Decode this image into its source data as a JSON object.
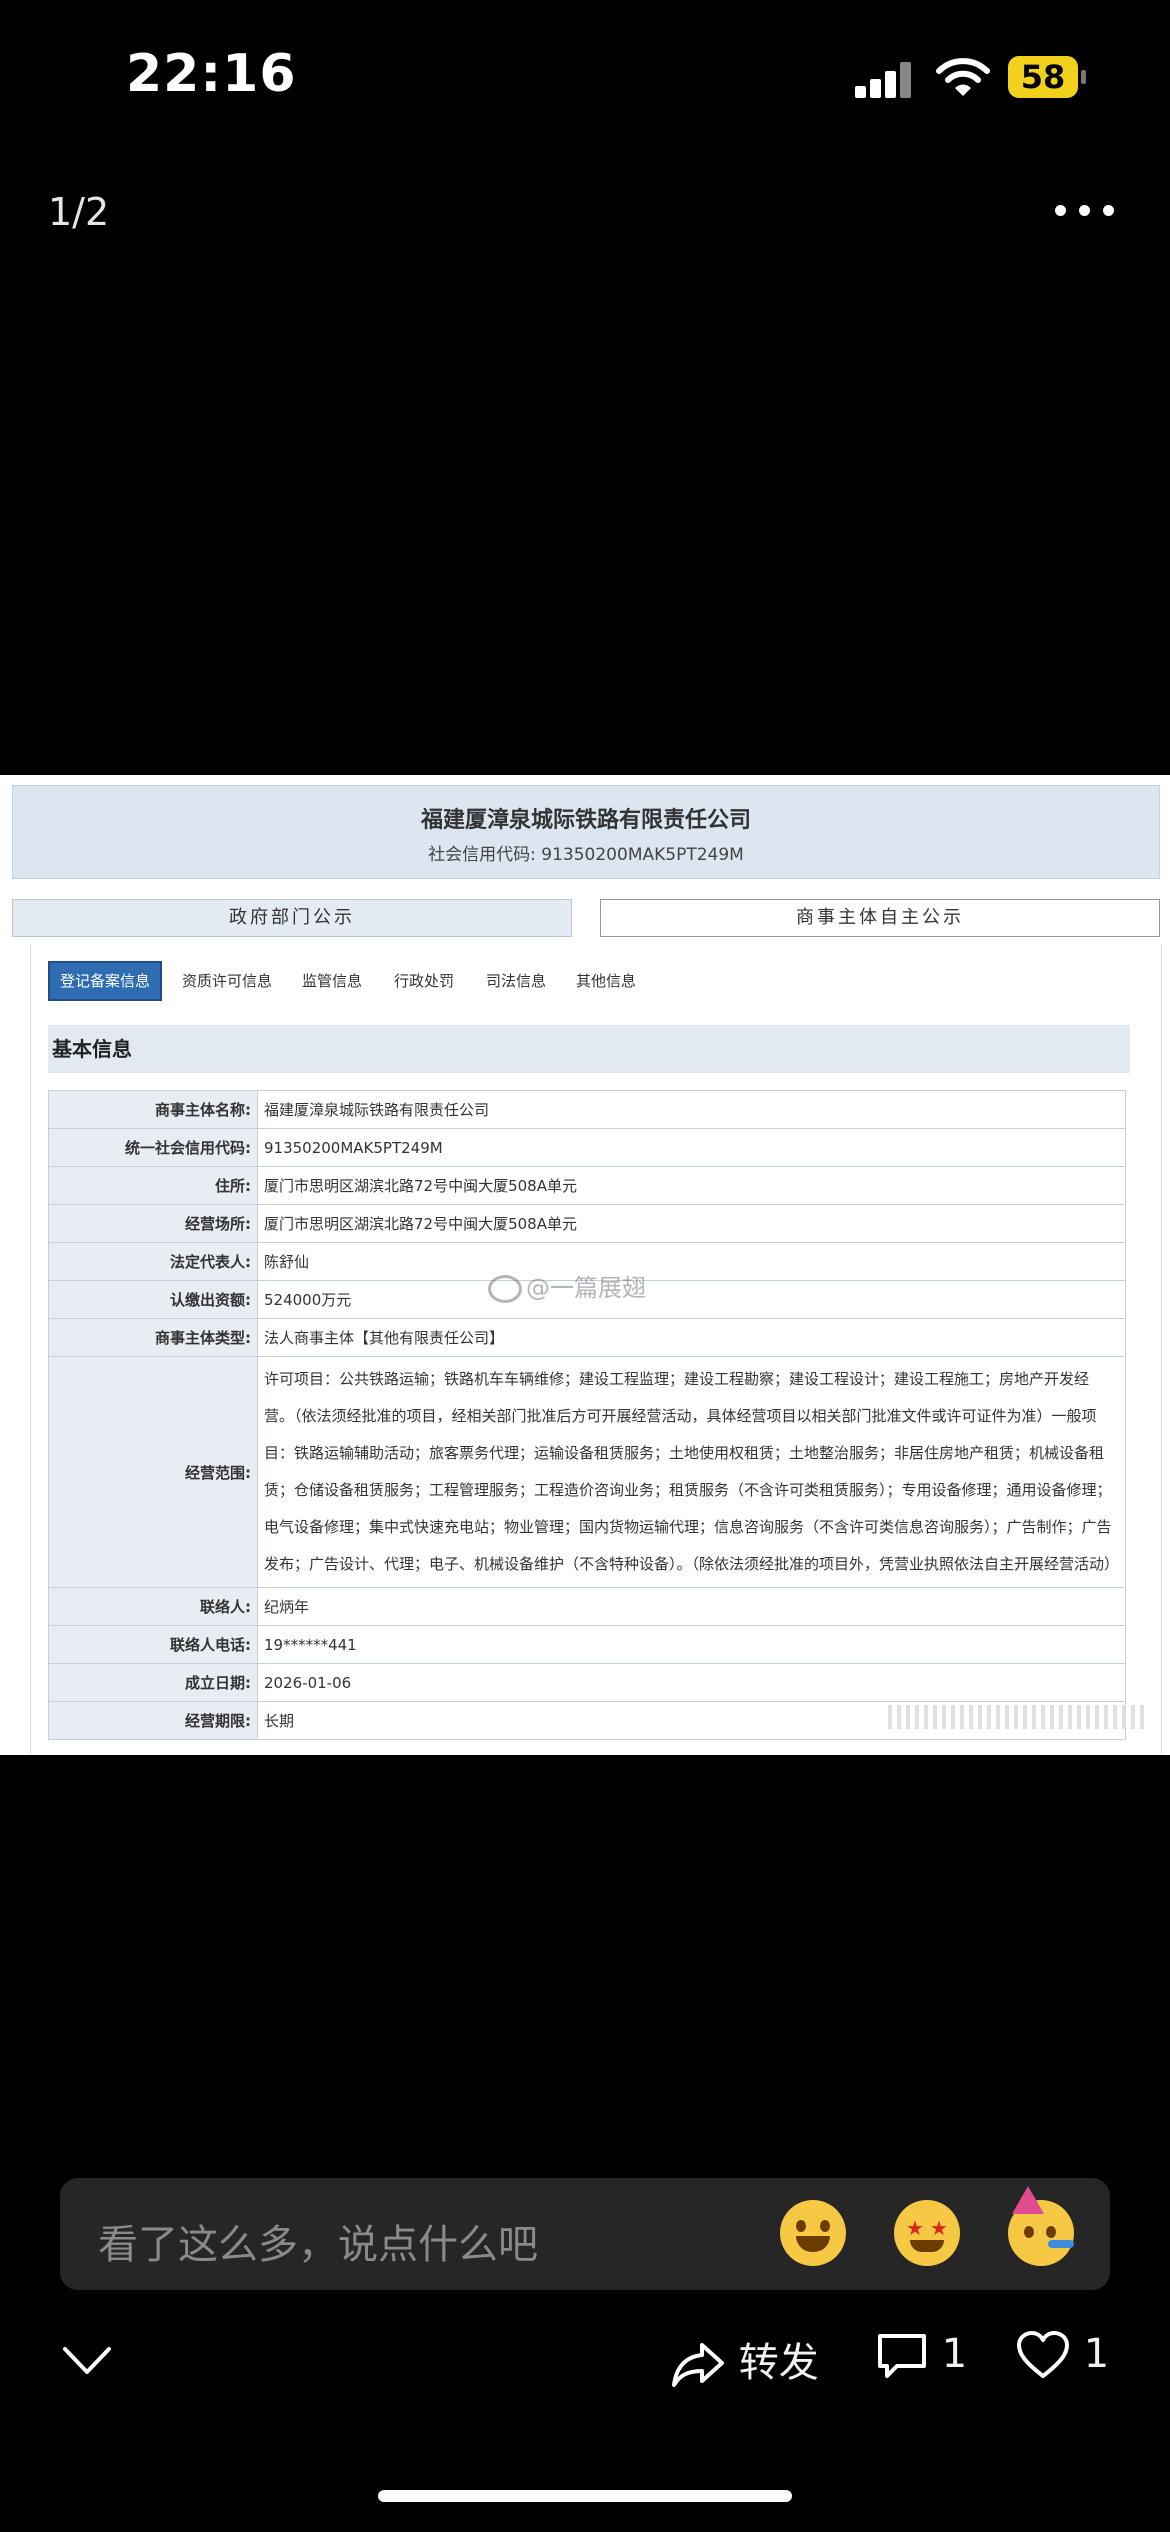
{
  "status_bar": {
    "time": "22:16",
    "battery": "58"
  },
  "viewer": {
    "page_counter": "1/2"
  },
  "document": {
    "company_title": "福建厦漳泉城际铁路有限责任公司",
    "credit_code_line": "社会信用代码: 91350200MAK5PT249M",
    "tab_gov": "政府部门公示",
    "tab_self": "商事主体自主公示",
    "subtabs": [
      "登记备案信息",
      "资质许可信息",
      "监管信息",
      "行政处罚",
      "司法信息",
      "其他信息"
    ],
    "section_title": "基本信息",
    "rows": [
      {
        "label": "商事主体名称:",
        "value": "福建厦漳泉城际铁路有限责任公司"
      },
      {
        "label": "统一社会信用代码:",
        "value": "91350200MAK5PT249M"
      },
      {
        "label": "住所:",
        "value": "厦门市思明区湖滨北路72号中闽大厦508A单元"
      },
      {
        "label": "经营场所:",
        "value": "厦门市思明区湖滨北路72号中闽大厦508A单元"
      },
      {
        "label": "法定代表人:",
        "value": "陈舒仙"
      },
      {
        "label": "认缴出资额:",
        "value": "524000万元"
      },
      {
        "label": "商事主体类型:",
        "value": "法人商事主体【其他有限责任公司】"
      },
      {
        "label": "经营范围:",
        "value": "许可项目：公共铁路运输；铁路机车车辆维修；建设工程监理；建设工程勘察；建设工程设计；建设工程施工；房地产开发经营。（依法须经批准的项目，经相关部门批准后方可开展经营活动，具体经营项目以相关部门批准文件或许可证件为准）一般项目：铁路运输辅助活动；旅客票务代理；运输设备租赁服务；土地使用权租赁；土地整治服务；非居住房地产租赁；机械设备租赁；仓储设备租赁服务；工程管理服务；工程造价咨询业务；租赁服务（不含许可类租赁服务）；专用设备修理；通用设备修理；电气设备修理；集中式快速充电站；物业管理；国内货物运输代理；信息咨询服务（不含许可类信息咨询服务）；广告制作；广告发布；广告设计、代理；电子、机械设备维护（不含特种设备）。（除依法须经批准的项目外，凭营业执照依法自主开展经营活动）"
      },
      {
        "label": "联络人:",
        "value": "纪炳年"
      },
      {
        "label": "联络人电话:",
        "value": "19******441"
      },
      {
        "label": "成立日期:",
        "value": "2026-01-06"
      },
      {
        "label": "经营期限:",
        "value": "长期"
      }
    ],
    "watermark": "@一篇展翅"
  },
  "comment": {
    "placeholder": "看了这么多，说点什么吧"
  },
  "actions": {
    "forward_label": "转发",
    "comment_count": "1",
    "like_count": "1"
  }
}
